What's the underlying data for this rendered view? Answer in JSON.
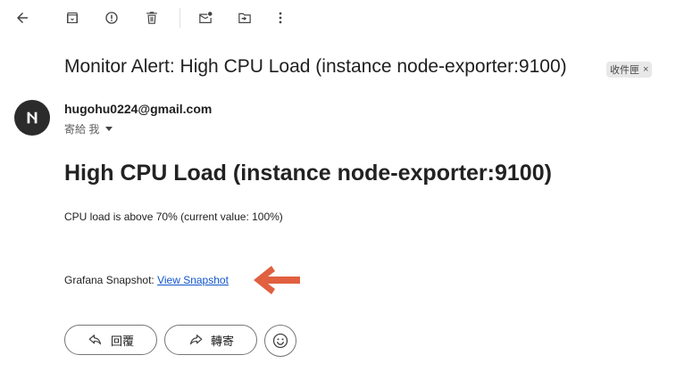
{
  "toolbar": {
    "icons": [
      "back-arrow-icon",
      "archive-icon",
      "report-spam-icon",
      "delete-icon",
      "mark-unread-icon",
      "move-to-icon",
      "more-vert-icon"
    ]
  },
  "message": {
    "subject": "Monitor Alert: High CPU Load (instance node-exporter:9100)",
    "label": "收件匣",
    "label_remove": "×",
    "sender_email": "hugohu0224@gmail.com",
    "to_me": "寄給 我",
    "body_title": "High CPU Load (instance node-exporter:9100)",
    "body_text": "CPU load is above 70% (current value: 100%)",
    "snapshot_prefix": "Grafana Snapshot: ",
    "snapshot_link": "View Snapshot"
  },
  "actions": {
    "reply_label": "回覆",
    "forward_label": "轉寄"
  },
  "colors": {
    "arrow": "#e06040",
    "link": "#1155cc",
    "avatar_bg": "#2b2b2b"
  }
}
